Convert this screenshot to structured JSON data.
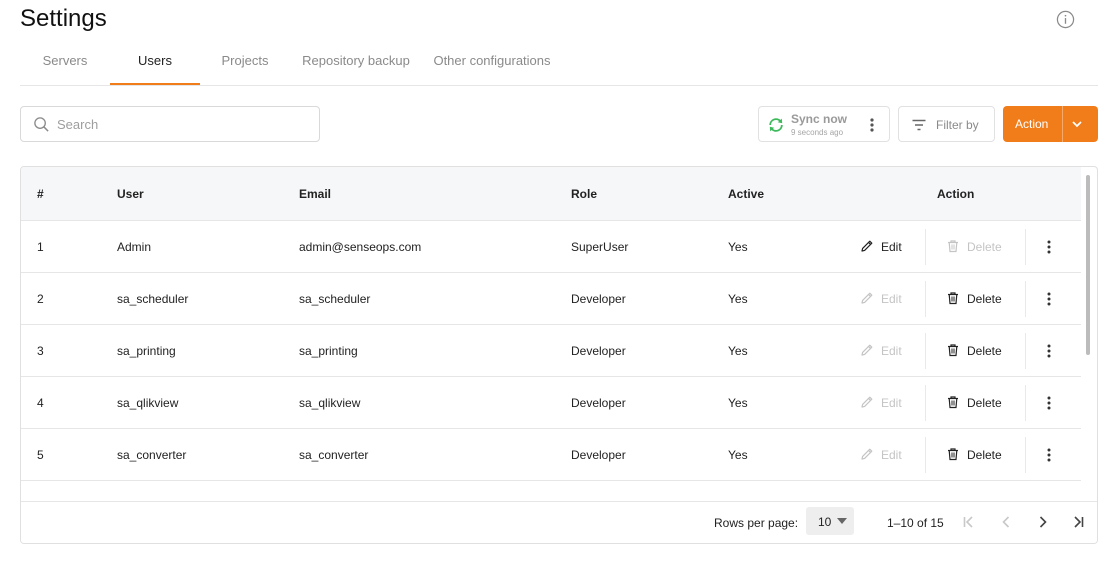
{
  "header": {
    "title": "Settings",
    "info_icon": "info-circle-icon"
  },
  "tabs": [
    {
      "label": "Servers",
      "active": false
    },
    {
      "label": "Users",
      "active": true
    },
    {
      "label": "Projects",
      "active": false
    },
    {
      "label": "Repository backup",
      "active": false
    },
    {
      "label": "Other configurations",
      "active": false
    }
  ],
  "toolbar": {
    "search_placeholder": "Search",
    "search_value": "",
    "sync_label": "Sync now",
    "sync_time": "9 seconds ago",
    "filter_label": "Filter by",
    "action_label": "Action"
  },
  "table": {
    "columns": [
      "#",
      "User",
      "Email",
      "Role",
      "Active",
      "Action"
    ],
    "rows": [
      {
        "num": "1",
        "user": "Admin",
        "email": "admin@senseops.com",
        "role": "SuperUser",
        "active": "Yes",
        "edit_enabled": true,
        "delete_enabled": false
      },
      {
        "num": "2",
        "user": "sa_scheduler",
        "email": "sa_scheduler",
        "role": "Developer",
        "active": "Yes",
        "edit_enabled": false,
        "delete_enabled": true
      },
      {
        "num": "3",
        "user": "sa_printing",
        "email": "sa_printing",
        "role": "Developer",
        "active": "Yes",
        "edit_enabled": false,
        "delete_enabled": true
      },
      {
        "num": "4",
        "user": "sa_qlikview",
        "email": "sa_qlikview",
        "role": "Developer",
        "active": "Yes",
        "edit_enabled": false,
        "delete_enabled": true
      },
      {
        "num": "5",
        "user": "sa_converter",
        "email": "sa_converter",
        "role": "Developer",
        "active": "Yes",
        "edit_enabled": false,
        "delete_enabled": true
      }
    ],
    "edit_label": "Edit",
    "delete_label": "Delete"
  },
  "pagination": {
    "rows_per_page_label": "Rows per page:",
    "rows_per_page_value": "10",
    "range": "1–10 of 15"
  },
  "colors": {
    "accent": "#f07d1a",
    "sync_green": "#3cb95b"
  }
}
